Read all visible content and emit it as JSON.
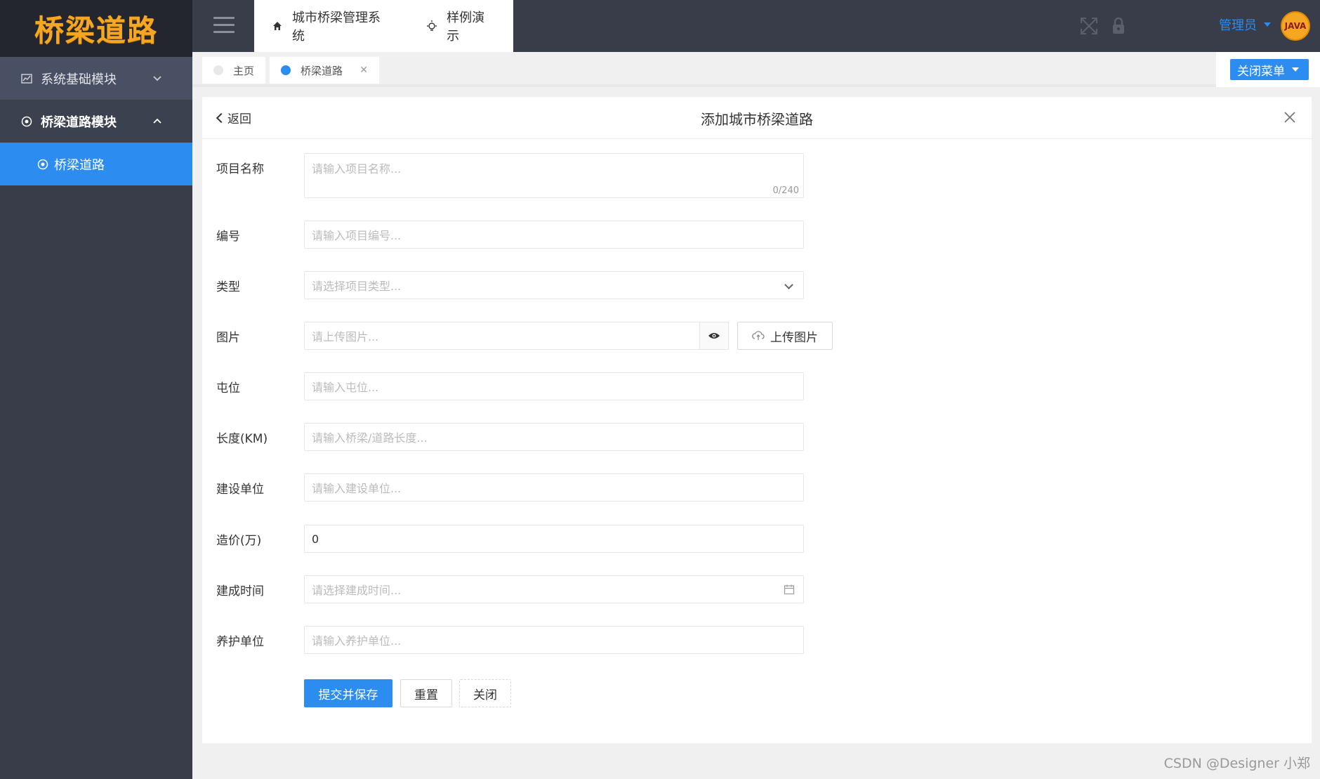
{
  "app": {
    "logo_text": "桥梁道路"
  },
  "sidebar": {
    "groups": [
      {
        "label": "系统基础模块",
        "expanded": false
      },
      {
        "label": "桥梁道路模块",
        "expanded": true
      }
    ],
    "active_item": "桥梁道路"
  },
  "header": {
    "top_tabs": [
      {
        "label": "城市桥梁管理系统",
        "icon": "home-icon"
      },
      {
        "label": "样例演示",
        "icon": "bulb-icon"
      }
    ],
    "admin_label": "管理员",
    "avatar_text": "JAVA"
  },
  "page_tabs": [
    {
      "label": "主页",
      "active": false
    },
    {
      "label": "桥梁道路",
      "active": true
    }
  ],
  "close_menu_label": "关闭菜单",
  "panel": {
    "back_label": "返回",
    "title": "添加城市桥梁道路"
  },
  "form": {
    "project_name": {
      "label": "项目名称",
      "placeholder": "请输入项目名称...",
      "counter": "0/240"
    },
    "code": {
      "label": "编号",
      "placeholder": "请输入项目编号..."
    },
    "type": {
      "label": "类型",
      "placeholder": "请选择项目类型..."
    },
    "image": {
      "label": "图片",
      "placeholder": "请上传图片...",
      "upload_label": "上传图片"
    },
    "station": {
      "label": "屯位",
      "placeholder": "请输入屯位..."
    },
    "length": {
      "label": "长度(KM)",
      "placeholder": "请输入桥梁/道路长度..."
    },
    "builder": {
      "label": "建设单位",
      "placeholder": "请输入建设单位..."
    },
    "cost": {
      "label": "造价(万)",
      "value": "0"
    },
    "build_time": {
      "label": "建成时间",
      "placeholder": "请选择建成时间..."
    },
    "maintainer": {
      "label": "养护单位",
      "placeholder": "请输入养护单位..."
    }
  },
  "buttons": {
    "submit": "提交并保存",
    "reset": "重置",
    "close": "关闭"
  },
  "watermark": "CSDN @Designer 小郑",
  "colors": {
    "primary": "#2d8cf0",
    "sidebar": "#393d49",
    "logo": "#f5a623"
  }
}
